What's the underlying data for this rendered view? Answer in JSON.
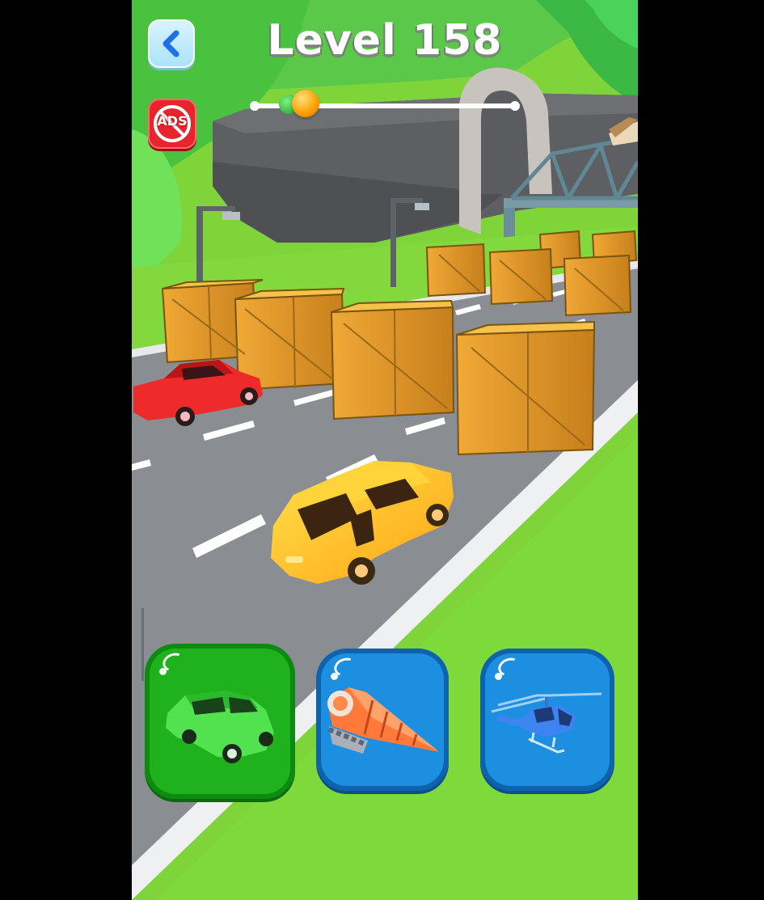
{
  "hud": {
    "level_title": "Level 158",
    "progress": 0.2,
    "back_icon": "chevron-left-icon",
    "ads_label": "ADS",
    "ads_icon": "no-ads-icon"
  },
  "vehicle_slots": [
    {
      "name": "car",
      "icon": "car-icon",
      "selected": true,
      "color": "#1fb21c"
    },
    {
      "name": "drill",
      "icon": "drill-icon",
      "selected": false,
      "color": "#1d8fe0"
    },
    {
      "name": "helicopter",
      "icon": "helicopter-icon",
      "selected": false,
      "color": "#1d8fe0"
    }
  ],
  "colors": {
    "grass": "#7fd43a",
    "road": "#8a8d92",
    "crate": "#e6a23a",
    "player_car": "#ffc21a",
    "opponent_car": "#ef2a2a"
  }
}
